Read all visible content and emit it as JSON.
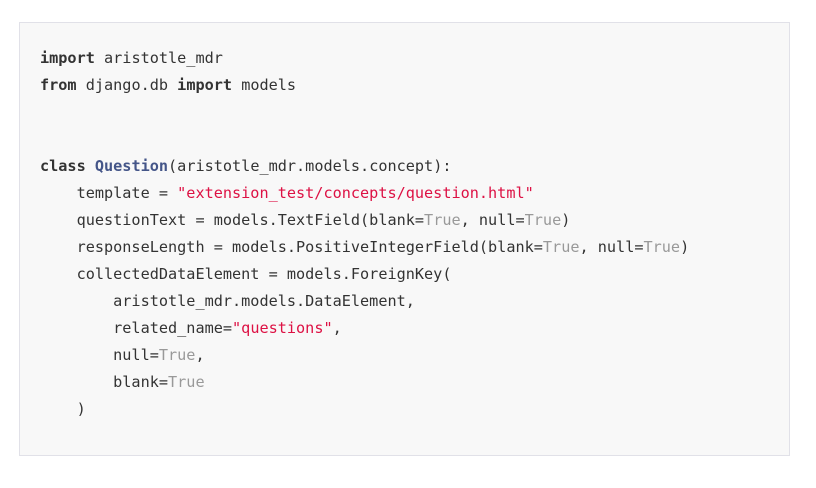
{
  "code": {
    "lines": [
      [
        {
          "t": "kw",
          "v": "import"
        },
        {
          "t": "plain",
          "v": " aristotle_mdr"
        }
      ],
      [
        {
          "t": "kw",
          "v": "from"
        },
        {
          "t": "plain",
          "v": " django.db "
        },
        {
          "t": "kw",
          "v": "import"
        },
        {
          "t": "plain",
          "v": " models"
        }
      ],
      [],
      [],
      [
        {
          "t": "kw",
          "v": "class"
        },
        {
          "t": "plain",
          "v": " "
        },
        {
          "t": "cls",
          "v": "Question"
        },
        {
          "t": "plain",
          "v": "(aristotle_mdr.models.concept):"
        }
      ],
      [
        {
          "t": "plain",
          "v": "    template = "
        },
        {
          "t": "str",
          "v": "\"extension_test/concepts/question.html\""
        }
      ],
      [
        {
          "t": "plain",
          "v": "    questionText = models.TextField(blank="
        },
        {
          "t": "bool",
          "v": "True"
        },
        {
          "t": "plain",
          "v": ", null="
        },
        {
          "t": "bool",
          "v": "True"
        },
        {
          "t": "plain",
          "v": ")"
        }
      ],
      [
        {
          "t": "plain",
          "v": "    responseLength = models.PositiveIntegerField(blank="
        },
        {
          "t": "bool",
          "v": "True"
        },
        {
          "t": "plain",
          "v": ", null="
        },
        {
          "t": "bool",
          "v": "True"
        },
        {
          "t": "plain",
          "v": ")"
        }
      ],
      [
        {
          "t": "plain",
          "v": "    collectedDataElement = models.ForeignKey("
        }
      ],
      [
        {
          "t": "plain",
          "v": "        aristotle_mdr.models.DataElement,"
        }
      ],
      [
        {
          "t": "plain",
          "v": "        related_name="
        },
        {
          "t": "str",
          "v": "\"questions\""
        },
        {
          "t": "plain",
          "v": ","
        }
      ],
      [
        {
          "t": "plain",
          "v": "        null="
        },
        {
          "t": "bool",
          "v": "True"
        },
        {
          "t": "plain",
          "v": ","
        }
      ],
      [
        {
          "t": "plain",
          "v": "        blank="
        },
        {
          "t": "bool",
          "v": "True"
        }
      ],
      [
        {
          "t": "plain",
          "v": "    )"
        }
      ]
    ]
  },
  "colors": {
    "background": "#f8f8f8",
    "border": "#e1e1e8",
    "keyword": "#333333",
    "class_name": "#445588",
    "string": "#dd1144",
    "boolean": "#999999"
  }
}
